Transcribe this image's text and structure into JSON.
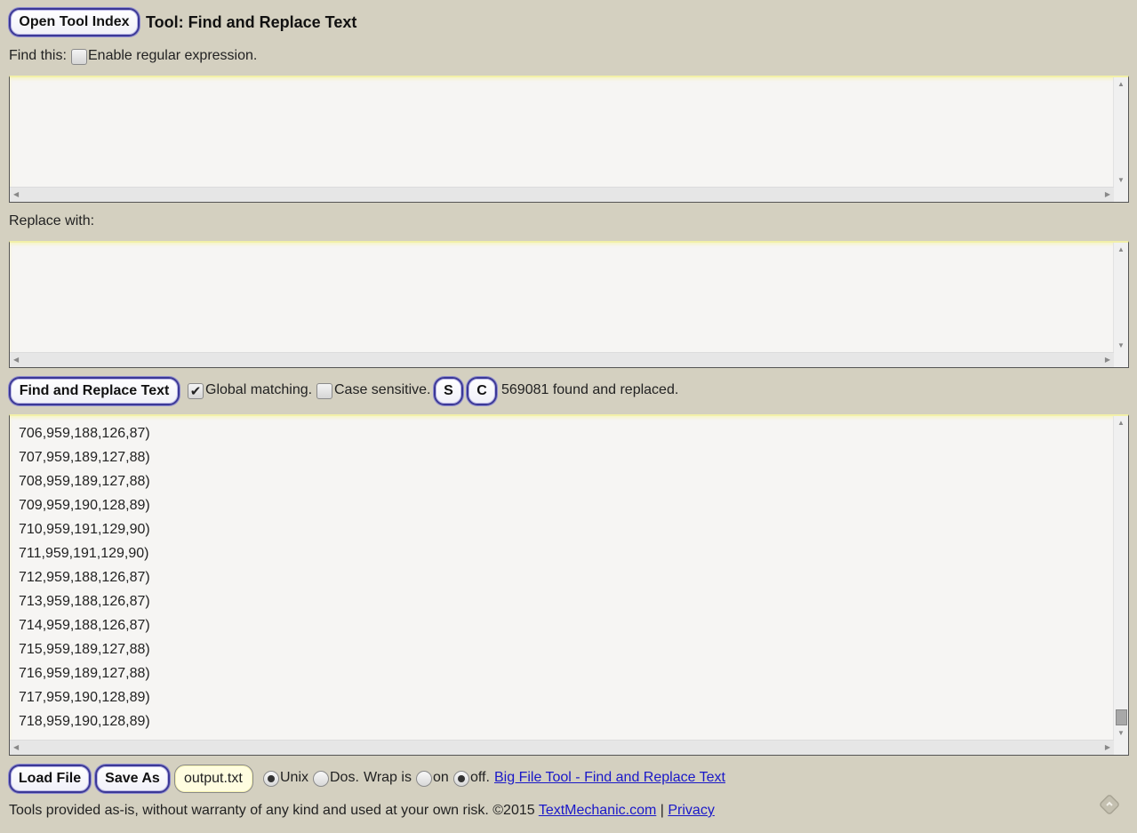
{
  "header": {
    "index_button": "Open Tool Index",
    "title": "Tool: Find and Replace Text"
  },
  "find": {
    "label": "Find this:",
    "regex_label": "Enable regular expression.",
    "regex_checked": false,
    "value": ""
  },
  "replace": {
    "label": "Replace with:",
    "value": ""
  },
  "actions": {
    "run_button": "Find and Replace Text",
    "global_label": "Global matching.",
    "global_checked": true,
    "case_label": "Case sensitive.",
    "case_checked": false,
    "s_button": "S",
    "c_button": "C",
    "status": "569081 found and replaced."
  },
  "output": {
    "lines": [
      "706,959,188,126,87)",
      "707,959,189,127,88)",
      "708,959,189,127,88)",
      "709,959,190,128,89)",
      "710,959,191,129,90)",
      "711,959,191,129,90)",
      "712,959,188,126,87)",
      "713,959,188,126,87)",
      "714,959,188,126,87)",
      "715,959,189,127,88)",
      "716,959,189,127,88)",
      "717,959,190,128,89)",
      "718,959,190,128,89)"
    ]
  },
  "bottom": {
    "load_button": "Load File",
    "save_button": "Save As",
    "filename": "output.txt",
    "unix_label": "Unix",
    "dos_label": "Dos.",
    "wrap_label": "Wrap is",
    "on_label": "on",
    "off_label": "off.",
    "line_ending": "Unix",
    "wrap": "off",
    "big_file_link": "Big File Tool - Find and Replace Text"
  },
  "footer": {
    "disclaimer": "Tools provided as-is, without warranty of any kind and used at your own risk. ©2015",
    "site_link": "TextMechanic.com",
    "separator": "|",
    "privacy_link": "Privacy"
  },
  "colors": {
    "background": "#d4d0c0",
    "button_border": "#3b3896",
    "link": "#1a18c8"
  }
}
